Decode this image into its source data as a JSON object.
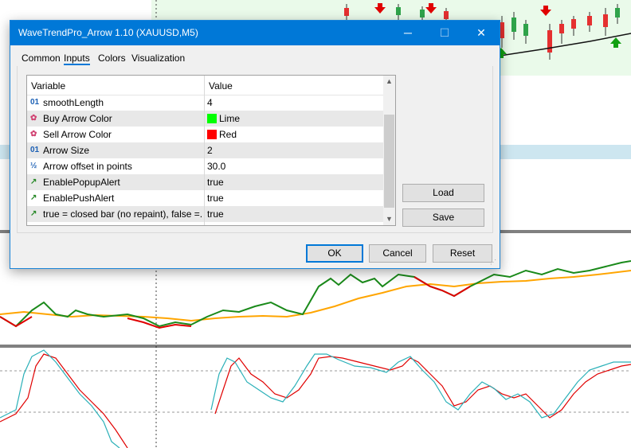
{
  "window": {
    "title": "WaveTrendPro_Arrow 1.10 (XAUUSD,M5)",
    "minimize_glyph": "─",
    "maximize_glyph": "☐",
    "close_glyph": "✕"
  },
  "tabs": [
    {
      "label": "Common",
      "active": false
    },
    {
      "label": "Inputs",
      "active": true
    },
    {
      "label": "Colors",
      "active": false
    },
    {
      "label": "Visualization",
      "active": false
    }
  ],
  "table": {
    "headers": {
      "variable": "Variable",
      "value": "Value"
    },
    "rows": [
      {
        "icon": "integer-icon",
        "glyph": "01",
        "name": "smoothLength",
        "value": "4"
      },
      {
        "icon": "color-icon",
        "glyph": "✿",
        "name": "Buy Arrow Color",
        "value": "Lime",
        "swatch": "#00ff00"
      },
      {
        "icon": "color-icon",
        "glyph": "✿",
        "name": "Sell Arrow Color",
        "value": "Red",
        "swatch": "#ff0000"
      },
      {
        "icon": "integer-icon",
        "glyph": "01",
        "name": "Arrow Size",
        "value": "2"
      },
      {
        "icon": "double-icon",
        "glyph": "½",
        "name": "Arrow offset in points",
        "value": "30.0"
      },
      {
        "icon": "boolean-icon",
        "glyph": "↗",
        "name": "EnablePopupAlert",
        "value": "true"
      },
      {
        "icon": "boolean-icon",
        "glyph": "↗",
        "name": "EnablePushAlert",
        "value": "true"
      },
      {
        "icon": "boolean-icon",
        "glyph": "↗",
        "name": "true = closed bar (no repaint), false =...",
        "value": "true"
      }
    ]
  },
  "scroll": {
    "up": "▲",
    "down": "▼"
  },
  "side_buttons": {
    "load": "Load",
    "save": "Save"
  },
  "footer_buttons": {
    "ok": "OK",
    "cancel": "Cancel",
    "reset": "Reset"
  },
  "colors": {
    "titlebar": "#0078d7",
    "bull_line": "#1a8a1a",
    "bear_line": "#e00000",
    "signal_line": "#ffa500",
    "osc_fast": "#e00000",
    "osc_slow": "#2ab0b8",
    "buy_arrow": "#12a012",
    "sell_arrow": "#e00000"
  }
}
